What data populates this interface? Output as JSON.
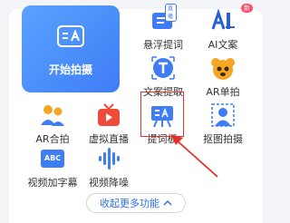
{
  "main_action": {
    "label": "开始拍摄"
  },
  "features": [
    {
      "label": "悬浮提词",
      "badge_text": "直播"
    },
    {
      "label": "AI文案",
      "badge_text": "新"
    },
    {
      "label": "文案提取"
    },
    {
      "label": "AR单拍"
    },
    {
      "label": "AR合拍"
    },
    {
      "label": "虚拟直播"
    },
    {
      "label": "提词板"
    },
    {
      "label": "抠图拍摄"
    },
    {
      "label": "视频加字幕",
      "icon_text": "ABC"
    },
    {
      "label": "视频降噪"
    }
  ],
  "collapse_button": {
    "label": "收起更多功能"
  },
  "colors": {
    "accent": "#3f7df6",
    "highlight": "#e0322b"
  }
}
